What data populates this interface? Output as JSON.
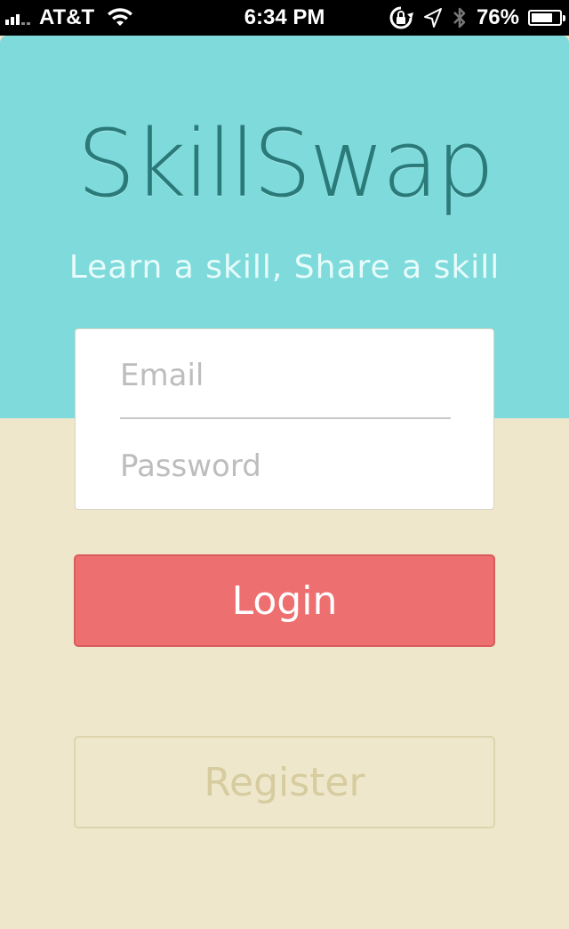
{
  "status_bar": {
    "carrier": "AT&T",
    "time": "6:34 PM",
    "battery": "76%",
    "battery_level": 0.76,
    "icons": [
      "signal-icon",
      "wifi-icon",
      "rotation-lock-icon",
      "location-arrow-icon",
      "bluetooth-icon",
      "battery-icon"
    ]
  },
  "app": {
    "name": "SkillSwap",
    "tagline": "Learn a skill, Share a skill"
  },
  "login_form": {
    "email_placeholder": "Email",
    "email_value": "",
    "password_placeholder": "Password",
    "password_value": ""
  },
  "buttons": {
    "login_label": "Login",
    "register_label": "Register"
  },
  "colors": {
    "hero_background": "#7fdbdb",
    "page_background": "#efe7cb",
    "logo_text": "#2b7a7a",
    "login_button": "#ee6f6f",
    "register_text": "#d6cc9f"
  }
}
